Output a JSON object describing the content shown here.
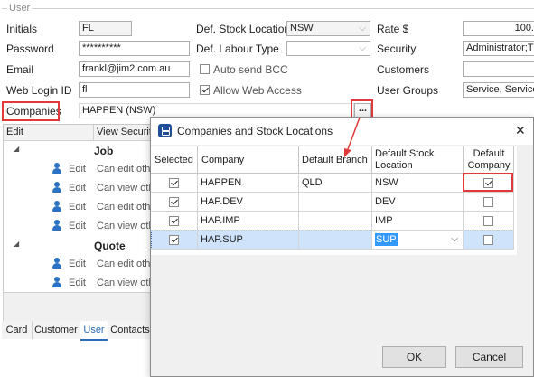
{
  "user_panel": {
    "group_title": "User",
    "initials_label": "Initials",
    "initials_value": "FL",
    "password_label": "Password",
    "password_value": "**********",
    "email_label": "Email",
    "email_value": "frankl@jim2.com.au",
    "web_login_label": "Web Login ID",
    "web_login_value": "fl",
    "companies_label": "Companies",
    "companies_value": "HAPPEN (NSW)",
    "companies_button": "...",
    "def_stock_label": "Def. Stock Location",
    "def_stock_value": "NSW",
    "def_labour_label": "Def. Labour Type",
    "def_labour_value": "",
    "auto_send_bcc_label": "Auto send BCC",
    "auto_send_bcc_checked": false,
    "allow_web_label": "Allow Web Access",
    "allow_web_checked": true,
    "rate_label": "Rate $",
    "rate_value": "100.",
    "security_label": "Security",
    "security_value": "Administrator;T",
    "customers_label": "Customers",
    "customers_value": "",
    "user_groups_label": "User Groups",
    "user_groups_value": "Service, Service"
  },
  "security_grid": {
    "col_edit": "Edit",
    "col_view": "View Security",
    "groups": [
      {
        "name": "Job",
        "rows": [
          {
            "action": "Edit",
            "text": "Can edit othe"
          },
          {
            "action": "Edit",
            "text": "Can view oth"
          },
          {
            "action": "Edit",
            "text": "Can edit othe"
          },
          {
            "action": "Edit",
            "text": "Can view oth"
          }
        ]
      },
      {
        "name": "Quote",
        "rows": [
          {
            "action": "Edit",
            "text": "Can edit othe"
          },
          {
            "action": "Edit",
            "text": "Can view oth"
          }
        ]
      }
    ]
  },
  "bottom_tabs": [
    "Card",
    "Customer",
    "User",
    "Contacts"
  ],
  "active_tab": "User",
  "dialog": {
    "title": "Companies and Stock Locations",
    "close_glyph": "✕",
    "columns": {
      "selected": "Selected",
      "company": "Company",
      "default_branch": "Default Branch",
      "default_stock_location": "Default Stock Location",
      "default_company": "Default Company"
    },
    "rows": [
      {
        "selected": true,
        "company": "HAPPEN",
        "branch": "QLD",
        "stock": "NSW",
        "default_company": true
      },
      {
        "selected": true,
        "company": "HAP.DEV",
        "branch": "",
        "stock": "DEV",
        "default_company": false
      },
      {
        "selected": true,
        "company": "HAP.IMP",
        "branch": "",
        "stock": "IMP",
        "default_company": false
      },
      {
        "selected": true,
        "company": "HAP.SUP",
        "branch": "",
        "stock": "SUP",
        "default_company": false
      }
    ],
    "ok_label": "OK",
    "cancel_label": "Cancel"
  },
  "colors": {
    "highlight_red": "#e03a3a",
    "selection_blue": "#3399ff",
    "selected_row": "#cfe3fa",
    "icon_blue": "#2c72c4"
  }
}
